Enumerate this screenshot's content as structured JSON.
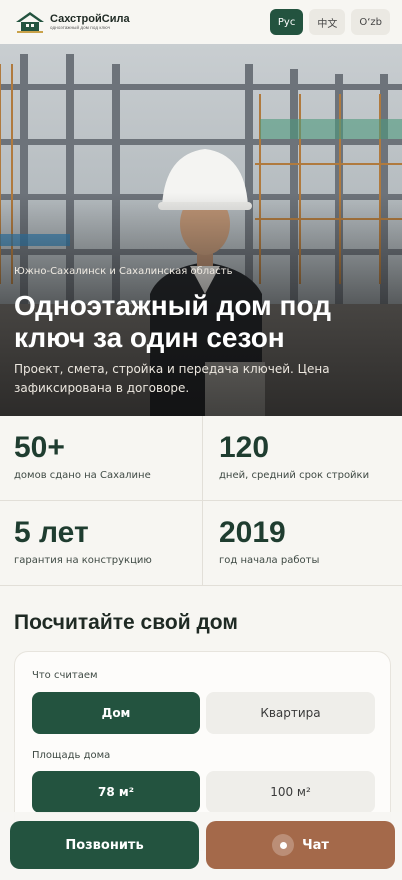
{
  "header": {
    "brand_name": "СахстройСила",
    "brand_tagline": "одноэтажный дом под ключ",
    "languages": [
      {
        "label": "Рус",
        "active": true
      },
      {
        "label": "中文",
        "active": false
      },
      {
        "label": "O‘zb",
        "active": false
      }
    ]
  },
  "hero": {
    "region": "Южно-Сахалинск и Сахалинская область",
    "title": "Одноэтажный дом под ключ за один сезон",
    "subtitle": "Проект, смета, стройка и передача ключей. Цена зафиксирована в договоре."
  },
  "stats": [
    {
      "value": "50+",
      "label": "домов сдано на Сахалине"
    },
    {
      "value": "120",
      "label": "дней, средний срок стройки"
    },
    {
      "value": "5 лет",
      "label": "гарантия на конструкцию"
    },
    {
      "value": "2019",
      "label": "год начала работы"
    }
  ],
  "calculator": {
    "title": "Посчитайте свой дом",
    "type_label": "Что считаем",
    "type_options": [
      "Дом",
      "Квартира"
    ],
    "area_label": "Площадь дома",
    "area_options": [
      "78 м²",
      "100 м²"
    ]
  },
  "actions": {
    "call_label": "Позвонить",
    "chat_label": "Чат"
  },
  "colors": {
    "brand_green": "#23533f",
    "accent_brown": "#a4694a",
    "background": "#f7f6f2"
  }
}
